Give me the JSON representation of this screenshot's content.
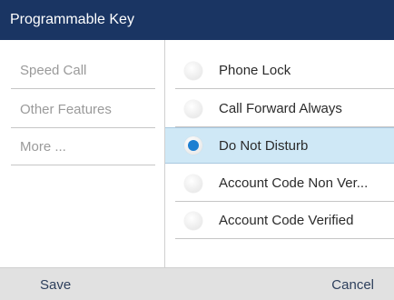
{
  "title": "Programmable Key",
  "left_menu": {
    "items": [
      {
        "label": "Speed Call"
      },
      {
        "label": "Other Features"
      },
      {
        "label": "More ..."
      }
    ]
  },
  "options": {
    "items": [
      {
        "label": "Phone Lock",
        "selected": false
      },
      {
        "label": "Call Forward Always",
        "selected": false
      },
      {
        "label": "Do Not Disturb",
        "selected": true
      },
      {
        "label": "Account Code Non Ver...",
        "selected": false
      },
      {
        "label": "Account Code Verified",
        "selected": false
      }
    ]
  },
  "softkeys": {
    "save_label": "Save",
    "cancel_label": "Cancel"
  },
  "colors": {
    "titlebar": "#1a3563",
    "selected_row": "#cfe8f6",
    "radio_dot": "#1d7fd1",
    "bottombar": "#e1e1e1"
  }
}
